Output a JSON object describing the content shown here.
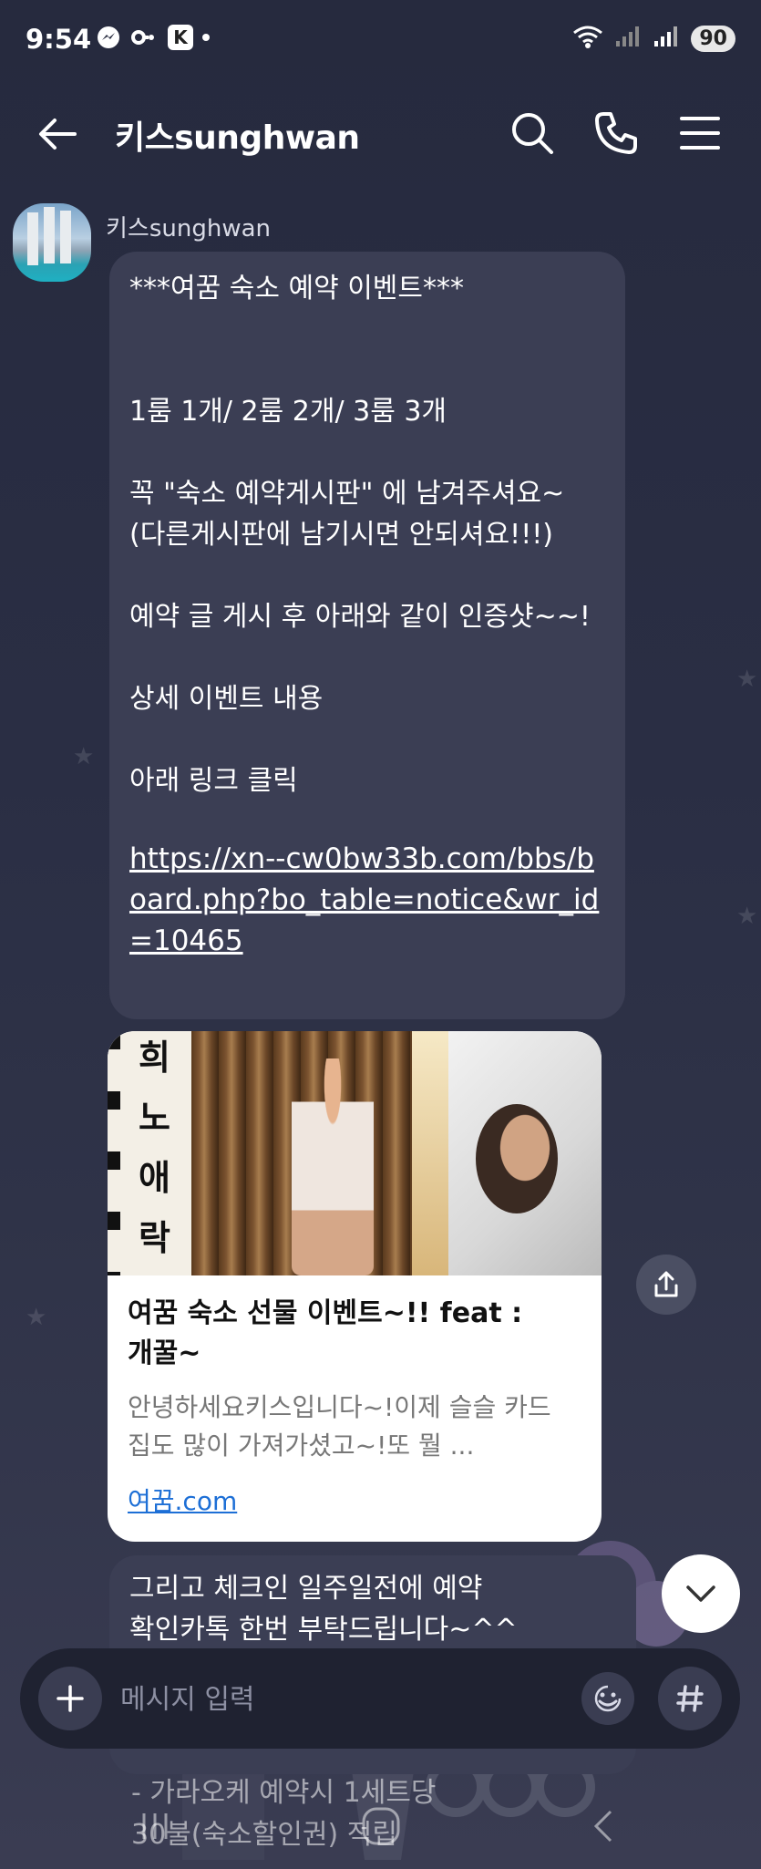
{
  "status_bar": {
    "time": "9:54",
    "battery": "90"
  },
  "header": {
    "title": "키스sunghwan"
  },
  "message1": {
    "sender": "키스sunghwan",
    "text": "***여꿈 숙소 예약 이벤트***\n\n\n1룸 1개/ 2룸 2개/ 3룸 3개\n\n꼭  \"숙소 예약게시판\" 에 남겨주셔요~\n(다른게시판에 남기시면 안되셔요!!!)\n\n예약 글 게시 후 아래와 같이 인증샷~~!\n\n상세 이벤트 내용\n\n아래 링크 클릭",
    "link": "https://xn--cw0bw33b.com/bbs/board.php?bo_table=notice&wr_id=10465"
  },
  "link_preview": {
    "image_text": [
      "희",
      "노",
      "애",
      "락"
    ],
    "title": "여꿈 숙소 선물 이벤트~!! feat : 개꿀~",
    "description": "안녕하세요키스입니다~!이제 슬슬 카드집도 많이 가져가셨고~!또 뭘 ...",
    "domain": "여꿈.com"
  },
  "message2": {
    "text": "그리고 체크인 일주일전에 예약\n확인카톡 한번 부탁드립니다~^^"
  },
  "background_text": "- 가라오케 예약시 1세트당\n30불(숙소할인권) 적립",
  "input": {
    "placeholder": "메시지 입력"
  },
  "colors": {
    "background": "#2a2e44",
    "bubble": "#3b3e54",
    "input_bar": "#1f2231",
    "link": "#1d6fd6"
  },
  "icons": [
    "messenger-icon",
    "link-icon",
    "k-app-icon",
    "wifi-icon",
    "signal-icon",
    "back-arrow-icon",
    "search-icon",
    "phone-icon",
    "menu-icon",
    "share-icon",
    "chevron-down-icon",
    "plus-icon",
    "emoji-icon",
    "hash-icon"
  ]
}
